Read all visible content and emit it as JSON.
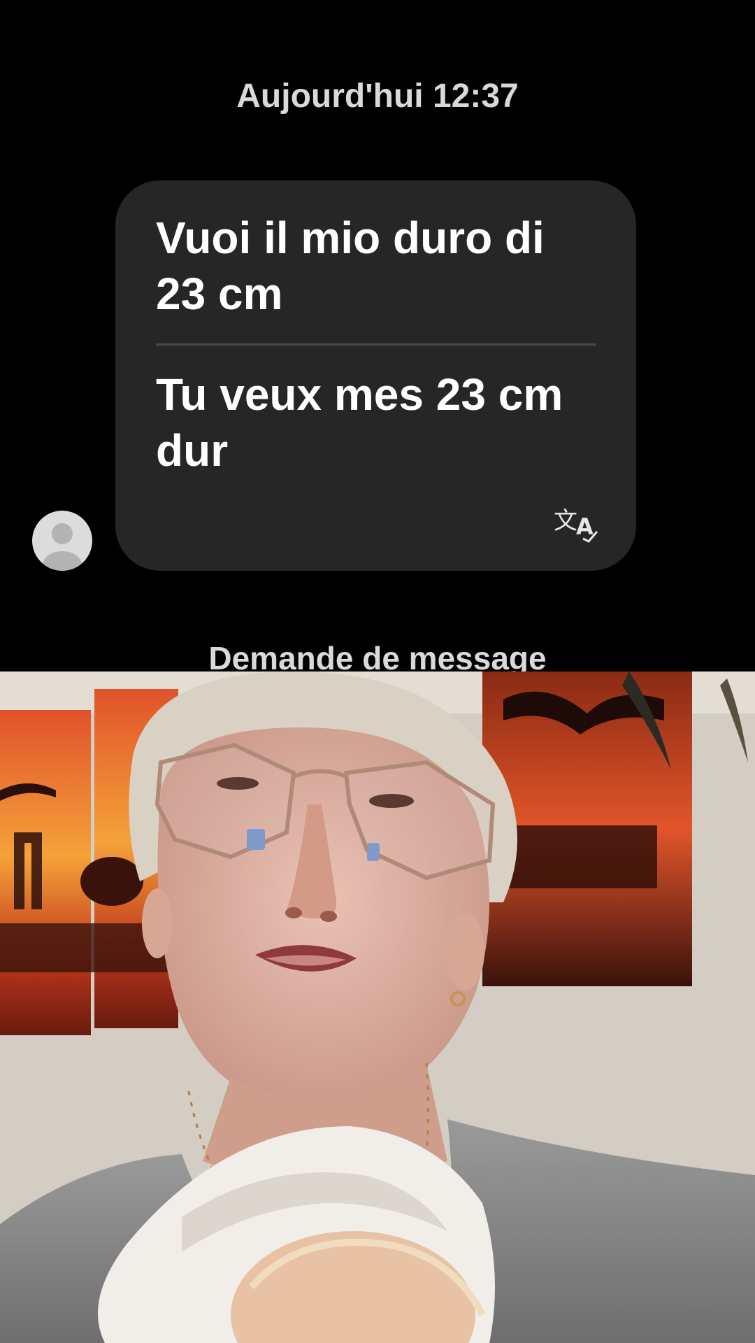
{
  "conversation": {
    "timestamp": "Aujourd'hui 12:37",
    "message": {
      "original_text": "Vuoi il mio duro di 23 cm",
      "translated_text": "Tu veux mes 23 cm dur",
      "translate_icon": "translate-icon"
    },
    "request_label": "Demande de message",
    "avatar_icon": "person-icon"
  },
  "video": {
    "description_icon": "camera-feed"
  },
  "colors": {
    "background": "#000000",
    "bubble": "#262626",
    "text": "#ffffff",
    "meta_text": "#d9d9d9"
  }
}
